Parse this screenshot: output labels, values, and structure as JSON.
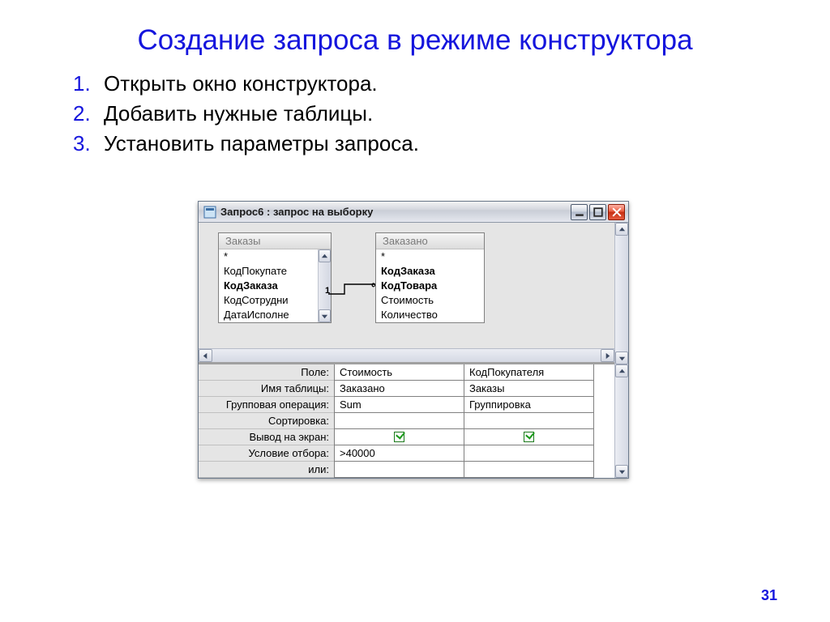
{
  "slide": {
    "title": "Создание запроса в режиме конструктора",
    "steps": [
      "Открыть окно конструктора.",
      "Добавить нужные таблицы.",
      "Установить параметры запроса."
    ],
    "page_number": "31"
  },
  "window": {
    "title": "Запрос6 : запрос на выборку",
    "tables": {
      "left": {
        "name": "Заказы",
        "fields": [
          {
            "text": "*",
            "bold": false
          },
          {
            "text": "КодПокупате",
            "bold": false
          },
          {
            "text": "КодЗаказа",
            "bold": true
          },
          {
            "text": "КодСотрудни",
            "bold": false
          },
          {
            "text": "ДатаИсполне",
            "bold": false
          }
        ]
      },
      "right": {
        "name": "Заказано",
        "fields": [
          {
            "text": "*",
            "bold": false
          },
          {
            "text": "КодЗаказа",
            "bold": true
          },
          {
            "text": "КодТовара",
            "bold": true
          },
          {
            "text": "Стоимость",
            "bold": false
          },
          {
            "text": "Количество",
            "bold": false
          }
        ]
      }
    },
    "relation": {
      "left_label": "1",
      "right_label": "∞"
    },
    "grid": {
      "row_labels": [
        "Поле:",
        "Имя таблицы:",
        "Групповая операция:",
        "Сортировка:",
        "Вывод на экран:",
        "Условие отбора:",
        "или:"
      ],
      "columns": [
        {
          "field": "Стоимость",
          "table": "Заказано",
          "group_op": "Sum",
          "sort": "",
          "show": true,
          "criteria": ">40000",
          "or": ""
        },
        {
          "field": "КодПокупателя",
          "table": "Заказы",
          "group_op": "Группировка",
          "sort": "",
          "show": true,
          "criteria": "",
          "or": ""
        }
      ]
    }
  }
}
